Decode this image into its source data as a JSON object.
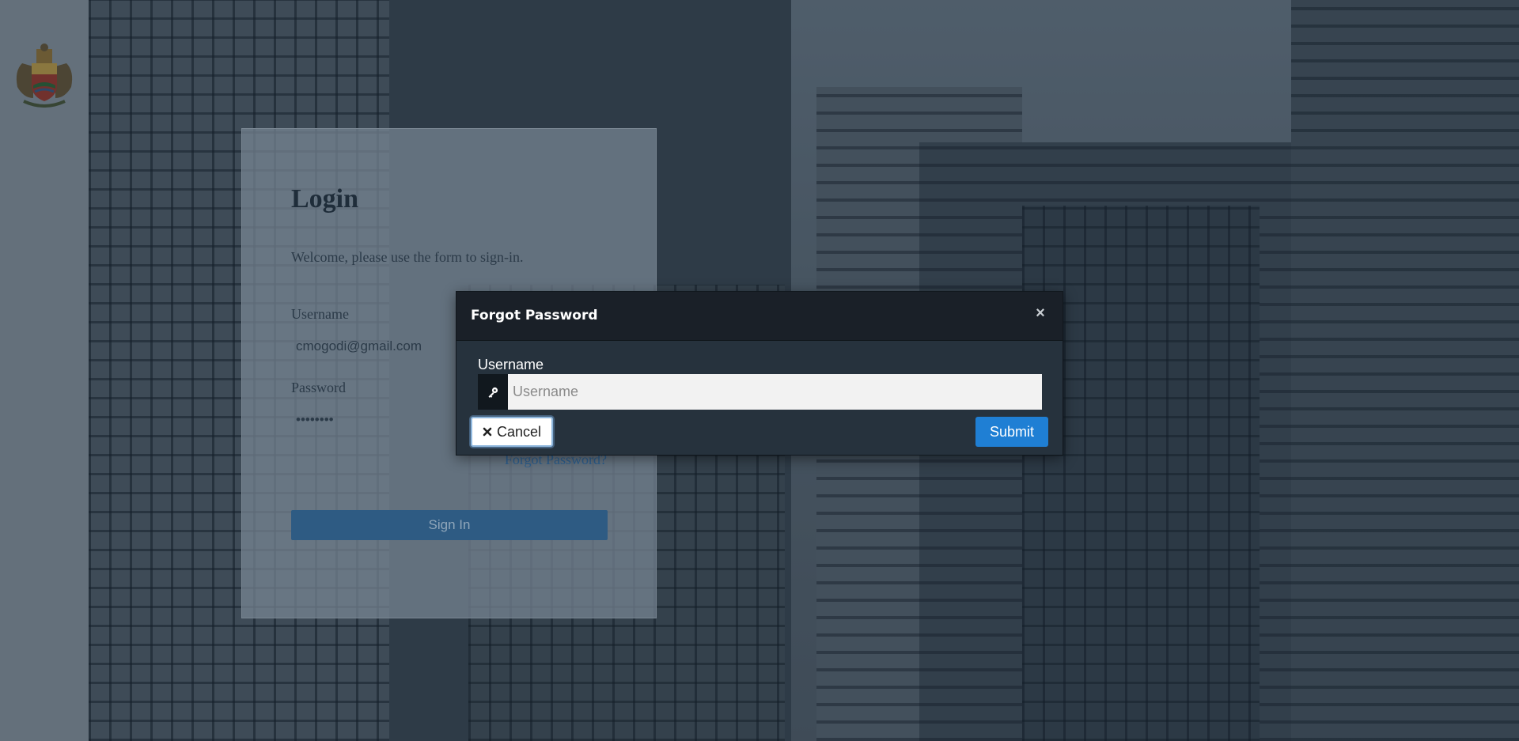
{
  "login": {
    "title": "Login",
    "subtitle": "Welcome, please use the form to sign-in.",
    "username_label": "Username",
    "username_value": "cmogodi@gmail.com",
    "password_label": "Password",
    "password_value": "••••••••",
    "forgot_link": "Forgot Password?",
    "signin_label": "Sign In"
  },
  "modal": {
    "title": "Forgot Password",
    "close_icon": "close-icon",
    "username_label": "Username",
    "username_placeholder": "Username",
    "username_value": "",
    "addon_icon": "key-icon",
    "cancel_label": "Cancel",
    "cancel_icon": "times-icon",
    "submit_label": "Submit"
  },
  "colors": {
    "modal_header": "#1a2028",
    "modal_body": "#26323d",
    "submit": "#1f7fd4",
    "signin": "#2e5b83",
    "link": "#2d5f8f"
  }
}
